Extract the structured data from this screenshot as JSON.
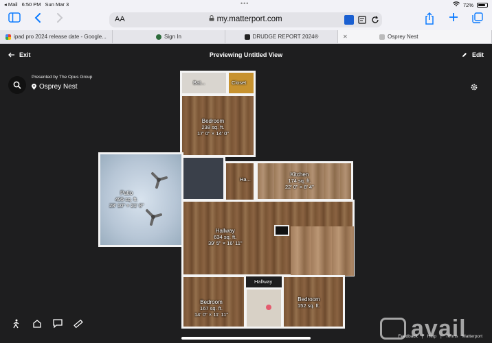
{
  "status": {
    "carrier": "◂ Mail",
    "time": "6:50 PM",
    "date": "Sun Mar 3",
    "dots": "•••",
    "battery": "72%"
  },
  "browser": {
    "aa_label": "AA",
    "url": "my.matterport.com",
    "tabs": [
      {
        "title": "ipad pro 2024 release date - Google..."
      },
      {
        "title": "Sign In"
      },
      {
        "title": "DRUDGE REPORT 2024®"
      },
      {
        "title": "Osprey Nest"
      }
    ]
  },
  "viewer": {
    "exit_label": "Exit",
    "title": "Previewing Untitled View",
    "edit_label": "Edit",
    "presented_by": "Presented by The Opus Group",
    "place": "Osprey Nest"
  },
  "rooms": [
    {
      "name": "Bat...",
      "area": "",
      "dims": ""
    },
    {
      "name": "Closet",
      "area": "",
      "dims": ""
    },
    {
      "name": "Bedroom",
      "area": "238 sq. ft.",
      "dims": "17' 0\" × 14' 0\""
    },
    {
      "name": "Patio",
      "area": "495 sq. ft.",
      "dims": "28' 10\" × 21' 8\""
    },
    {
      "name": "Ha...",
      "area": "",
      "dims": ""
    },
    {
      "name": "Kitchen",
      "area": "174 sq. ft.",
      "dims": "22' 0\" × 8' 4\""
    },
    {
      "name": "Hallway",
      "area": "634 sq. ft.",
      "dims": "39' 5\" × 16' 11\""
    },
    {
      "name": "Hallway",
      "area": "",
      "dims": ""
    },
    {
      "name": "Bedroom",
      "area": "167 sq. ft.",
      "dims": "14' 0\" × 11' 11\""
    },
    {
      "name": "Bedroom",
      "area": "152 sq. ft.",
      "dims": ""
    }
  ],
  "footer": {
    "feedback": "Feedback",
    "help": "Help",
    "terms": "Terms",
    "brand": "Matterport"
  },
  "watermark": "avail"
}
